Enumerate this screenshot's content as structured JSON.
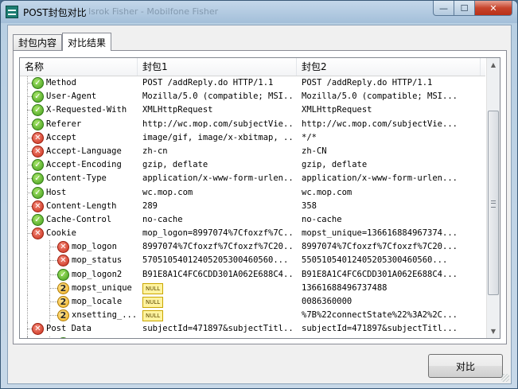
{
  "window": {
    "title": "POST封包对比",
    "ghost_title": "Isrok Fisher - Mobilfone Fisher",
    "min_glyph": "—",
    "max_glyph": "☐",
    "close_glyph": "✕"
  },
  "tabs": [
    {
      "label": "封包内容",
      "active": false
    },
    {
      "label": "对比结果",
      "active": true
    }
  ],
  "grid": {
    "headers": [
      "名称",
      "封包1",
      "封包2",
      ""
    ],
    "rows": [
      {
        "name": "Method",
        "status": "ok",
        "level": 0,
        "expandable": false,
        "v1": "POST /addReply.do HTTP/1.1",
        "v2": "POST /addReply.do HTTP/1.1"
      },
      {
        "name": "User-Agent",
        "status": "ok",
        "level": 0,
        "expandable": false,
        "v1": "Mozilla/5.0 (compatible; MSI...",
        "v2": "Mozilla/5.0 (compatible; MSI..."
      },
      {
        "name": "X-Requested-With",
        "status": "ok",
        "level": 0,
        "expandable": false,
        "v1": "XMLHttpRequest",
        "v2": "XMLHttpRequest"
      },
      {
        "name": "Referer",
        "status": "ok",
        "level": 0,
        "expandable": false,
        "v1": "http://wc.mop.com/subjectVie...",
        "v2": "http://wc.mop.com/subjectVie..."
      },
      {
        "name": "Accept",
        "status": "err",
        "level": 0,
        "expandable": false,
        "v1": "image/gif, image/x-xbitmap, ...",
        "v2": "*/*"
      },
      {
        "name": "Accept-Language",
        "status": "err",
        "level": 0,
        "expandable": false,
        "v1": "zh-cn",
        "v2": "zh-CN"
      },
      {
        "name": "Accept-Encoding",
        "status": "ok",
        "level": 0,
        "expandable": false,
        "v1": "gzip, deflate",
        "v2": "gzip, deflate"
      },
      {
        "name": "Content-Type",
        "status": "ok",
        "level": 0,
        "expandable": false,
        "v1": "application/x-www-form-urlen...",
        "v2": "application/x-www-form-urlen..."
      },
      {
        "name": "Host",
        "status": "ok",
        "level": 0,
        "expandable": false,
        "v1": "wc.mop.com",
        "v2": "wc.mop.com"
      },
      {
        "name": "Content-Length",
        "status": "err",
        "level": 0,
        "expandable": false,
        "v1": "289",
        "v2": "358"
      },
      {
        "name": "Cache-Control",
        "status": "ok",
        "level": 0,
        "expandable": false,
        "v1": "no-cache",
        "v2": "no-cache"
      },
      {
        "name": "Cookie",
        "status": "err",
        "level": 0,
        "expandable": true,
        "v1": "mop_logon=8997074%7Cfoxzf%7C...",
        "v2": "mopst_unique=136616884967374..."
      },
      {
        "name": "mop_logon",
        "status": "err",
        "level": 1,
        "expandable": false,
        "v1": "8997074%7Cfoxzf%7Cfoxzf%7C20...",
        "v2": "8997074%7Cfoxzf%7Cfoxzf%7C20..."
      },
      {
        "name": "mop_status",
        "status": "err",
        "level": 1,
        "expandable": false,
        "v1": "57051054012405205300460560...",
        "v2": "55051054012405205300460560..."
      },
      {
        "name": "mop_logon2",
        "status": "ok",
        "level": 1,
        "expandable": false,
        "v1": "B91E8A1C4FC6CDD301A062E688C4...",
        "v2": "B91E8A1C4FC6CDD301A062E688C4..."
      },
      {
        "name": "mopst_unique",
        "status": "two",
        "level": 1,
        "expandable": false,
        "v1": "",
        "v1_null": "NULL",
        "v2": "13661688496737488"
      },
      {
        "name": "mop_locale",
        "status": "two",
        "level": 1,
        "expandable": false,
        "v1": "",
        "v1_null": "NULL",
        "v2": "0086360000"
      },
      {
        "name": "xnsetting_...",
        "status": "two",
        "level": 1,
        "expandable": false,
        "v1": "",
        "v1_null": "NULL",
        "v2": "%7B%22connectState%22%3A2%2C..."
      },
      {
        "name": "Post Data",
        "status": "err",
        "level": 0,
        "expandable": true,
        "v1": "subjectId=471897&subjectTitl...",
        "v2": "subjectId=471897&subjectTitl..."
      },
      {
        "name": "",
        "status": "ok",
        "level": 1,
        "expandable": false,
        "v1": "",
        "v2": ""
      }
    ]
  },
  "icons": {
    "ok": {
      "glyph": "✓",
      "color": "#3f9a1a"
    },
    "err": {
      "glyph": "✕",
      "color": "#c82e1a"
    },
    "two": {
      "glyph": "2",
      "color": "#f2b01e"
    }
  },
  "scrollbar": {
    "up_glyph": "▲",
    "down_glyph": "▼"
  },
  "buttons": {
    "compare": "对比"
  }
}
